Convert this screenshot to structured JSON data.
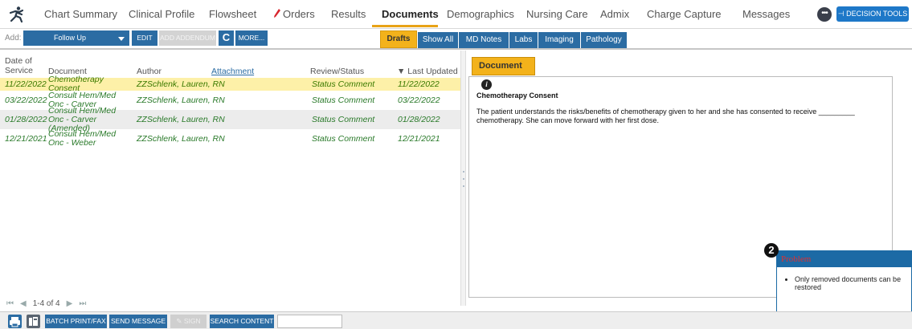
{
  "nav": {
    "tabs": [
      {
        "label": "Chart Summary"
      },
      {
        "label": "Clinical Profile"
      },
      {
        "label": "Flowsheet"
      },
      {
        "label": "Orders"
      },
      {
        "label": "Results"
      },
      {
        "label": "Documents"
      },
      {
        "label": "Demographics"
      },
      {
        "label": "Nursing Care"
      },
      {
        "label": "Admix"
      },
      {
        "label": "Charge Capture"
      },
      {
        "label": "Messages"
      }
    ],
    "active_tab": "Documents",
    "more_label": "•••",
    "decision_tools_label": "⊣ DECISION TOOLS",
    "accent_color": "#e8a317"
  },
  "toolbar": {
    "add_label": "Add:",
    "add_select_value": "Follow Up",
    "edit_label": "EDIT",
    "add_addendum_label": "ADD ADDENDUM",
    "refresh_label": "C",
    "more_label": "MORE..."
  },
  "filter_tabs": [
    {
      "label": "Drafts"
    },
    {
      "label": "Show All"
    },
    {
      "label": "MD Notes"
    },
    {
      "label": "Labs"
    },
    {
      "label": "Imaging"
    },
    {
      "label": "Pathology"
    }
  ],
  "active_filter": "Drafts",
  "table": {
    "headers": {
      "date_line1": "Date of",
      "date_line2": "Service",
      "document": "Document",
      "author": "Author",
      "attachment": "Attachment",
      "review": "Review/Status",
      "updated": "▼ Last Updated"
    },
    "rows": [
      {
        "date": "11/22/2022",
        "doc": "Chemotherapy Consent",
        "author": "ZZSchlenk, Lauren, RN",
        "status": "Status Comment",
        "updated": "11/22/2022"
      },
      {
        "date": "03/22/2022",
        "doc": "Consult Hem/Med Onc - Carver",
        "author": "ZZSchlenk, Lauren, RN",
        "status": "Status Comment",
        "updated": "03/22/2022"
      },
      {
        "date": "01/28/2022",
        "doc": "Consult Hem/Med Onc - Carver (Amended)",
        "author": "ZZSchlenk, Lauren, RN",
        "status": "Status Comment",
        "updated": "01/28/2022"
      },
      {
        "date": "12/21/2021",
        "doc": "Consult Hem/Med Onc - Weber",
        "author": "ZZSchlenk, Lauren, RN",
        "status": "Status Comment",
        "updated": "12/21/2021"
      }
    ]
  },
  "pager": {
    "text": "1-4 of 4"
  },
  "document": {
    "tab_label": "Document",
    "title": "Chemotherapy Consent",
    "body": "The patient understands the risks/benefits of chemotherapy given to her and she has consented to receive _________ chemotherapy. She can move forward with her first dose."
  },
  "problem": {
    "badge": "2",
    "title": "Problem",
    "message": "Only removed documents can be restored"
  },
  "bottom": {
    "batch_print_label": "BATCH PRINT/FAX",
    "send_message_label": "SEND MESSAGE",
    "sign_label": "SIGN",
    "search_content_label": "SEARCH CONTENT",
    "search_value": ""
  }
}
